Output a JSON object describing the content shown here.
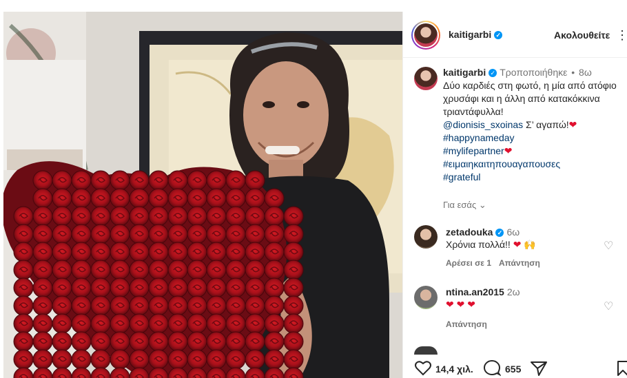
{
  "post": {
    "username": "kaitigarbi",
    "follow_label": "Ακολουθείτε",
    "more_icon": "more-icon"
  },
  "caption": {
    "username": "kaitigarbi",
    "edited": "Τροποποιήθηκε",
    "dot": "•",
    "time": "8ω",
    "line1": "Δύο καρδιές στη φωτό, η μία από ατόφιο χρυσάφι και η άλλη από κατακόκκινα τριαντάφυλλα!",
    "mention": "@dionisis_sxoinas",
    "mention_tail": " Σ’ αγαπώ!",
    "hashtags": [
      "#happynameday",
      "#mylifepartner",
      "#ειμαιηκαιτηπουαγαπουσες",
      "#grateful"
    ],
    "for_you": "Για εσάς"
  },
  "comments": [
    {
      "username": "zetadouka",
      "time": "6ω",
      "text": "Χρόνια πολλά!!",
      "likes": "Αρέσει σε 1",
      "reply": "Απάντηση"
    },
    {
      "username": "ntina.an2015",
      "time": "2ω",
      "text": "",
      "likes": "",
      "reply": "Απάντηση"
    }
  ],
  "stats": {
    "likes": "14,4 χιλ.",
    "comments": "655"
  },
  "colors": {
    "verified": "#0095f6",
    "link": "#00376b",
    "muted": "#737373",
    "heart": "#e0102e"
  }
}
